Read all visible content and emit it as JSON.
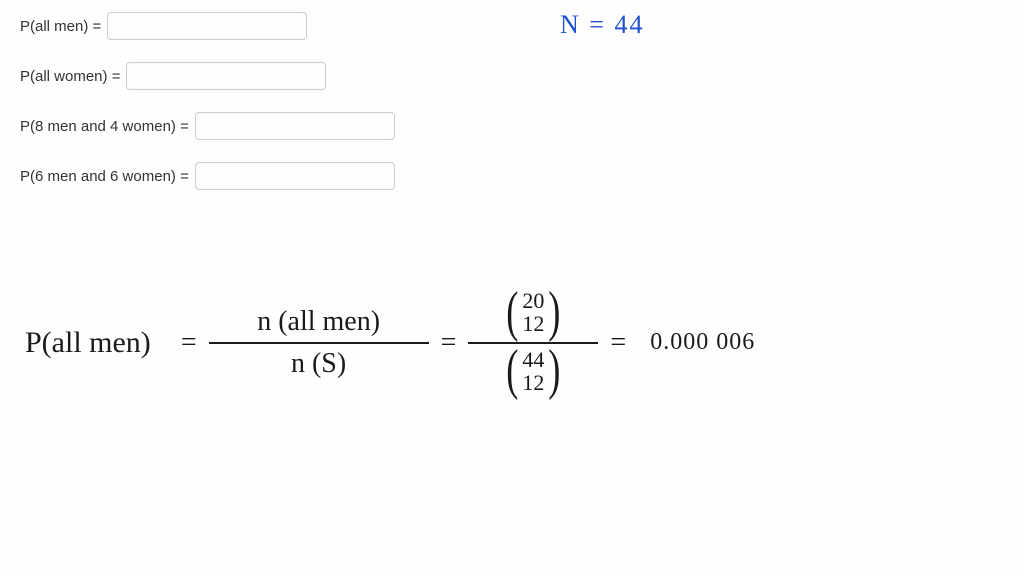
{
  "form": {
    "rows": [
      {
        "label": "P(all men) =",
        "value": ""
      },
      {
        "label": "P(all women) =",
        "value": ""
      },
      {
        "label": "P(8 men and 4 women) =",
        "value": ""
      },
      {
        "label": "P(6 men and 6 women) =",
        "value": ""
      }
    ]
  },
  "annotation": {
    "n_equals": "N = 44"
  },
  "work": {
    "lhs": "P(all men)",
    "eq1": "=",
    "frac1_top": "n (all men)",
    "frac1_bot": "n (S)",
    "eq2": "=",
    "binom_top_n": "20",
    "binom_top_k": "12",
    "binom_bot_n": "44",
    "binom_bot_k": "12",
    "eq3": "=",
    "result": "0.000 006"
  }
}
